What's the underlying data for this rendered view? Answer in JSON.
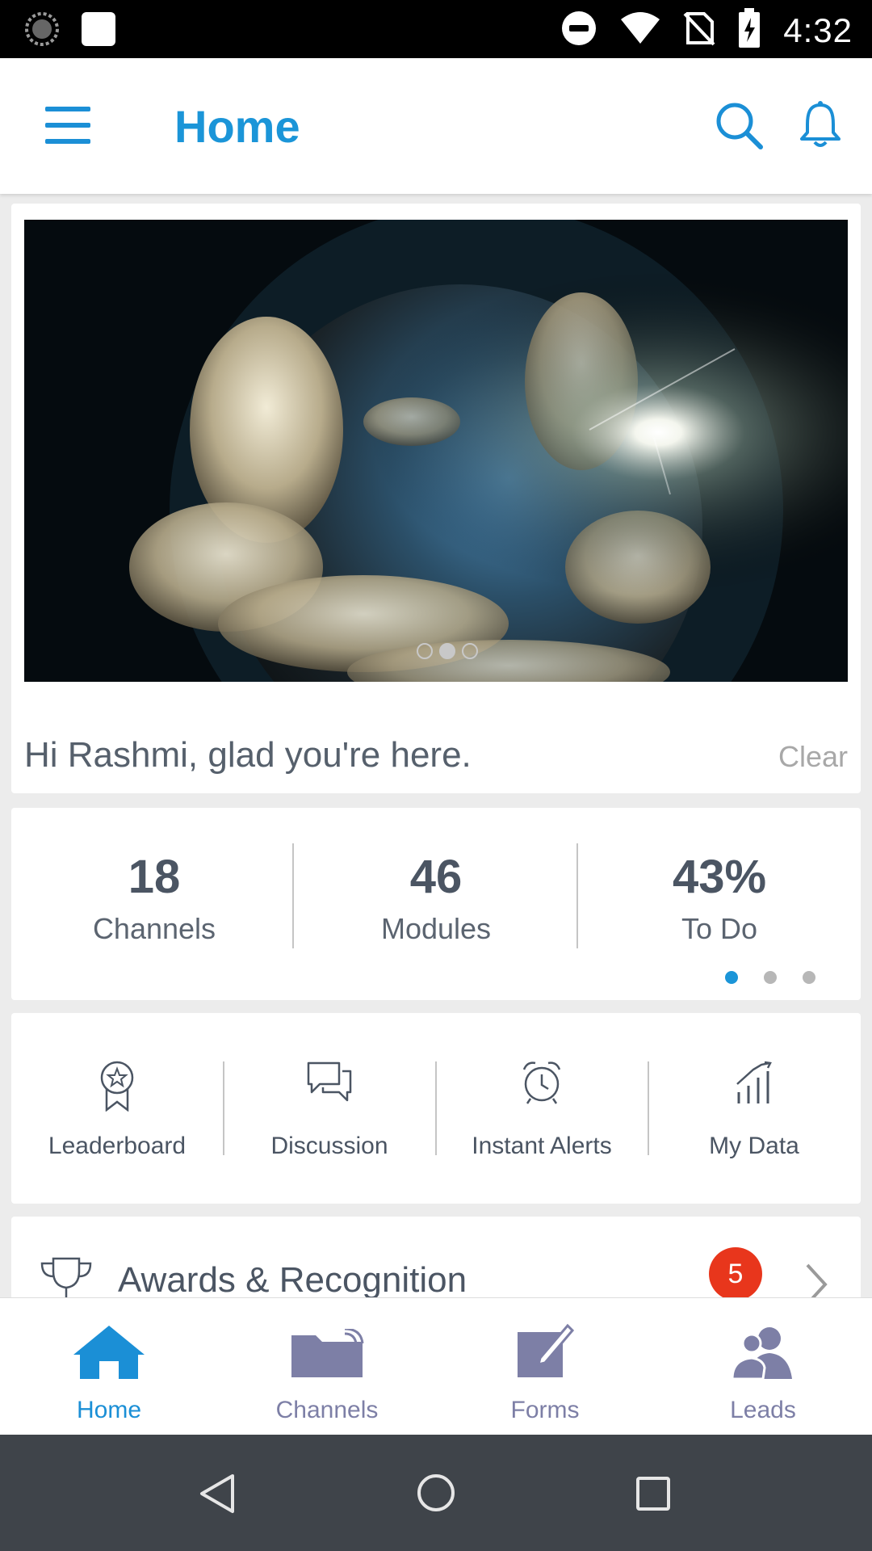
{
  "status_bar": {
    "time": "4:32",
    "left_icons": [
      "loading-icon",
      "notification-square-icon"
    ],
    "right_icons": [
      "do-not-disturb-icon",
      "wifi-icon",
      "no-sim-icon",
      "battery-charging-icon"
    ]
  },
  "app_bar": {
    "title": "Home",
    "accent_color": "#1b95d8"
  },
  "hero": {
    "image_alt": "Earth covered in clouds with sun glare",
    "slide_count": 3,
    "active_slide": 2,
    "greeting": "Hi Rashmi, glad you're here.",
    "clear_label": "Clear"
  },
  "stats": {
    "items": [
      {
        "value": "18",
        "label": "Channels"
      },
      {
        "value": "46",
        "label": "Modules"
      },
      {
        "value": "43%",
        "label": "To Do"
      }
    ],
    "page_count": 3,
    "active_page": 1
  },
  "shortcuts": {
    "items": [
      {
        "label": "Leaderboard",
        "icon": "award-ribbon-icon"
      },
      {
        "label": "Discussion",
        "icon": "chat-bubbles-icon"
      },
      {
        "label": "Instant Alerts",
        "icon": "alarm-clock-icon"
      },
      {
        "label": "My Data",
        "icon": "bar-chart-icon"
      }
    ]
  },
  "awards": {
    "label": "Awards & Recognition",
    "badge_count": "5",
    "badge_color": "#e8361c"
  },
  "bottom_nav": {
    "items": [
      {
        "label": "Home",
        "icon": "home-icon",
        "active": true
      },
      {
        "label": "Channels",
        "icon": "folder-icon",
        "active": false
      },
      {
        "label": "Forms",
        "icon": "edit-form-icon",
        "active": false
      },
      {
        "label": "Leads",
        "icon": "users-icon",
        "active": false
      }
    ],
    "active_color": "#1b8fd6",
    "inactive_color": "#7d7fa6"
  },
  "system_nav": {
    "buttons": [
      "back-icon",
      "home-circle-icon",
      "recents-icon"
    ]
  }
}
